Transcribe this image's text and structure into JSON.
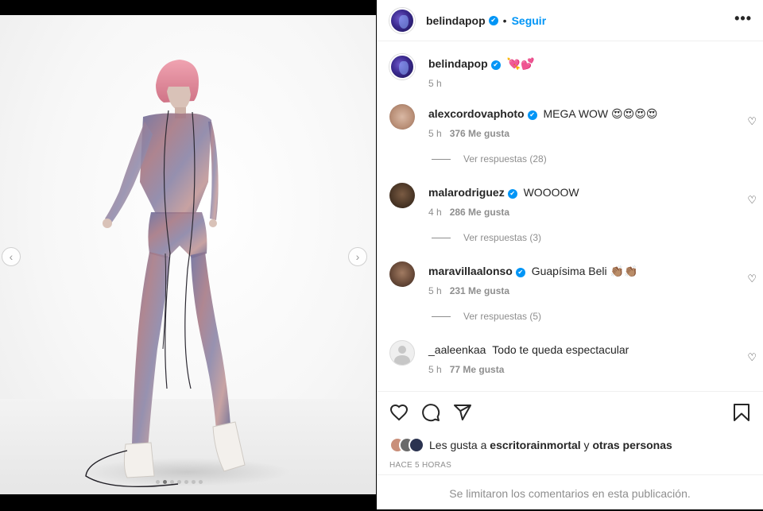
{
  "header": {
    "username": "belindapop",
    "verified_mark": "✔",
    "separator": "•",
    "follow_label": "Seguir",
    "more_label": "•••"
  },
  "caption": {
    "username": "belindapop",
    "text": "💘💕",
    "time": "5 h"
  },
  "comments": [
    {
      "username": "alexcordovaphoto",
      "verified": true,
      "text": "MEGA WOW 😍😍😍😍",
      "time": "5 h",
      "likes": "376 Me gusta",
      "replies": "Ver respuestas (28)"
    },
    {
      "username": "malarodriguez",
      "verified": true,
      "text": "WOOOOW",
      "time": "4 h",
      "likes": "286 Me gusta",
      "replies": "Ver respuestas (3)"
    },
    {
      "username": "maravillaalonso",
      "verified": true,
      "text": "Guapísima Beli 👏🏽👏🏽",
      "time": "5 h",
      "likes": "231 Me gusta",
      "replies": "Ver respuestas (5)"
    },
    {
      "username": "_aaleenkaa",
      "verified": false,
      "text": "Todo te queda espectacular",
      "time": "5 h",
      "likes": "77 Me gusta",
      "replies": ""
    }
  ],
  "icons": {
    "like": "heart-icon",
    "comment": "comment-icon",
    "share": "share-icon",
    "save": "bookmark-icon",
    "comment_like": "heart-icon",
    "prev": "chevron-left-icon",
    "next": "chevron-right-icon"
  },
  "likes": {
    "prefix": "Les gusta a",
    "user": "escritorainmortal",
    "conj": "y",
    "others": "otras personas"
  },
  "timestamp": "HACE 5 HORAS",
  "comments_limited": "Se limitaron los comentarios en esta publicación.",
  "carousel": {
    "count": 7,
    "active_index": 1,
    "prev_glyph": "‹",
    "next_glyph": "›"
  },
  "colors": {
    "accent": "#0095f6",
    "muted": "#8e8e8e",
    "text": "#262626"
  }
}
